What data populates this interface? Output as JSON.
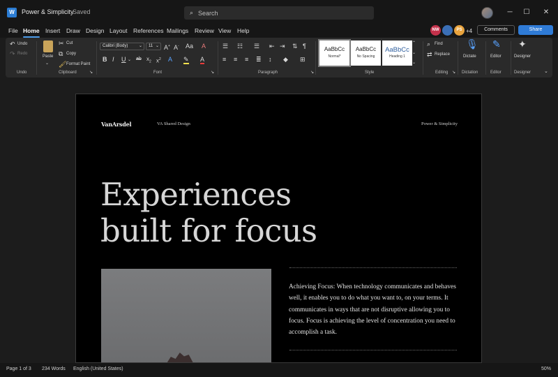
{
  "window": {
    "title": "Power & Simplicity",
    "status": "Saved",
    "search_placeholder": "Search",
    "controls": {
      "minimize": "─",
      "maximize": "☐",
      "close": "✕"
    }
  },
  "menu": {
    "tabs": [
      "File",
      "Home",
      "Insert",
      "Draw",
      "Design",
      "Layout",
      "References",
      "Mailings",
      "Review",
      "View",
      "Help"
    ],
    "active": "Home"
  },
  "collaborators": {
    "avatars": [
      {
        "initials": "NW",
        "color": "#c4314b"
      },
      {
        "initials": "",
        "color": "#3b6fb6"
      },
      {
        "initials": "PS",
        "color": "#e8a33d"
      }
    ],
    "more": "+4",
    "comments_label": "Comments",
    "share_label": "Share"
  },
  "ribbon": {
    "undo": {
      "undo": "Undo",
      "redo": "Redo",
      "group": "Undo"
    },
    "clipboard": {
      "paste": "Paste",
      "cut": "Cut",
      "copy": "Copy",
      "format_painter": "Format Paint",
      "group": "Clipboard"
    },
    "font": {
      "family": "Calibri (Body)",
      "size": "11",
      "group": "Font"
    },
    "paragraph": {
      "group": "Paragraph"
    },
    "styles": {
      "cards": [
        {
          "preview": "AaBbCc",
          "name": "Normal*"
        },
        {
          "preview": "AaBbCc",
          "name": "No Spacing"
        },
        {
          "preview": "AaBbCc",
          "name": "Heading 1"
        }
      ],
      "group": "Style"
    },
    "editing": {
      "find": "Find",
      "replace": "Replace",
      "group": "Editing"
    },
    "dictate": {
      "label": "Dictate",
      "group": "Dictation"
    },
    "editor": {
      "label": "Editor",
      "group": "Editor"
    },
    "designer": {
      "label": "Designer",
      "group": "Designer"
    }
  },
  "document": {
    "logo": "VanArsdel",
    "shared_design": "VA Shared Design",
    "running_head": "Power & Simplicity",
    "headline_line1": "Experiences",
    "headline_line2": "built for focus",
    "body": "Achieving Focus: When technology communicates and behaves well, it enables you to do what you want to, on your terms. It communicates in ways that are not disruptive allowing you to focus. Focus is achieving the level of concentration you need to accomplish a task."
  },
  "statusbar": {
    "page": "Page 1 of 3",
    "words": "234 Words",
    "language": "English (United States)",
    "zoom": "50%"
  },
  "colors": {
    "accent": "#2f7bd6",
    "word_blue": "#2b7cd3"
  }
}
